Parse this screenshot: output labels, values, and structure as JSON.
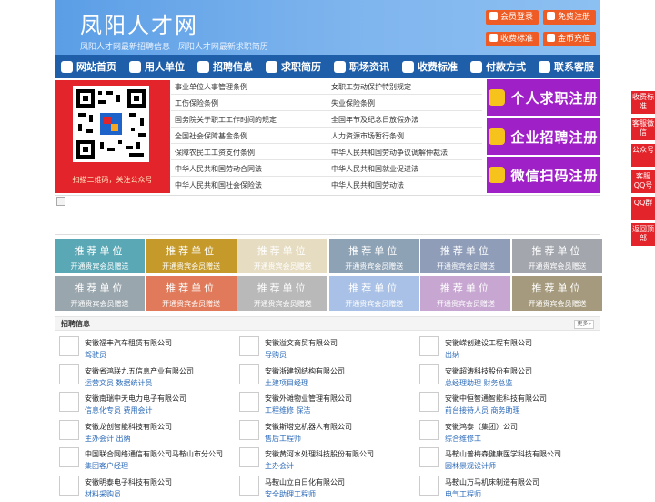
{
  "header": {
    "site_name": "凤阳人才网",
    "sub_links": [
      "凤阳人才网最新招聘信息",
      "凤阳人才网最新求职简历"
    ],
    "buttons": [
      {
        "label": "会员登录",
        "icon": "user-icon"
      },
      {
        "label": "免费注册",
        "icon": "register-icon"
      },
      {
        "label": "收费标准",
        "icon": "price-icon"
      },
      {
        "label": "金币充值",
        "icon": "coin-icon"
      }
    ],
    "accent": "#ef5b24"
  },
  "nav": {
    "items": [
      {
        "label": "网站首页",
        "icon": "home-icon"
      },
      {
        "label": "用人单位",
        "icon": "building-icon"
      },
      {
        "label": "招聘信息",
        "icon": "recruit-icon"
      },
      {
        "label": "求职简历",
        "icon": "resume-icon"
      },
      {
        "label": "职场资讯",
        "icon": "news-icon"
      },
      {
        "label": "收费标准",
        "icon": "price-icon"
      },
      {
        "label": "付款方式",
        "icon": "payment-icon"
      },
      {
        "label": "联系客服",
        "icon": "phone-icon"
      }
    ],
    "color": "#1f5ea8"
  },
  "qr": {
    "caption": "扫描二维码，关注公众号"
  },
  "laws": {
    "left": [
      "事业单位人事管理条例",
      "工伤保险条例",
      "国务院关于职工工作时间的规定",
      "全国社会保障基金条例",
      "保障农民工工资支付条例",
      "中华人民共和国劳动合同法",
      "中华人民共和国社会保险法"
    ],
    "right": [
      "女职工劳动保护特别规定",
      "失业保险条例",
      "全国年节及纪念日放假办法",
      "人力资源市场暂行条例",
      "中华人民共和国劳动争议调解仲裁法",
      "中华人民共和国就业促进法",
      "中华人民共和国劳动法"
    ]
  },
  "register": [
    {
      "label": "个人求职注册",
      "icon": "person-icon"
    },
    {
      "label": "企业招聘注册",
      "icon": "company-icon"
    },
    {
      "label": "微信扫码注册",
      "icon": "wechat-icon"
    }
  ],
  "recommend": {
    "title": "推荐单位",
    "subtitle": "开通贵宾会员赠送",
    "colors": [
      "#5aa8b5",
      "#c59a2b",
      "#e6dcc2",
      "#8ea2b5",
      "#8f9db8",
      "#a3a6ad",
      "#9aa6ad",
      "#e07a5a",
      "#b9b9b9",
      "#a9c1e6",
      "#c7a7d1",
      "#a59a7d"
    ]
  },
  "jobs": {
    "title": "招聘信息",
    "more_label": "更多»",
    "items": [
      {
        "company": "安徽福丰汽车租赁有限公司",
        "positions": "驾驶员"
      },
      {
        "company": "安徽溢文商贸有限公司",
        "positions": "导购员"
      },
      {
        "company": "安徽嵘创建设工程有限公司",
        "positions": "出纳"
      },
      {
        "company": "安徽省鸿联九五信息产业有限公司",
        "positions": "运营文员 数据统计员"
      },
      {
        "company": "安徽浙建钢结构有限公司",
        "positions": "土建项目经理"
      },
      {
        "company": "安徽超涛科技股份有限公司",
        "positions": "总经理助理 财务总监"
      },
      {
        "company": "安徽南瑞中天电力电子有限公司",
        "positions": "信息化专员 费用会计"
      },
      {
        "company": "安徽外滩物业管理有限公司",
        "positions": "工程维修 保洁"
      },
      {
        "company": "安徽中恒智通智能科技有限公司",
        "positions": "前台接待人员 商务助理"
      },
      {
        "company": "安徽龙创智能科技有限公司",
        "positions": "主办会计 出纳"
      },
      {
        "company": "安徽斯塔克机器人有限公司",
        "positions": "售后工程师"
      },
      {
        "company": "安徽鸿泰（集团）公司",
        "positions": "综合维修工"
      },
      {
        "company": "中国联合网络通信有限公司马鞍山市分公司",
        "positions": "集团客户经理"
      },
      {
        "company": "安徽黄河水处理科技股份有限公司",
        "positions": "主办会计"
      },
      {
        "company": "马鞍山普梅森健康医学科技有限公司",
        "positions": "园林景观设计师"
      },
      {
        "company": "安徽明泰电子科技有限公司",
        "positions": "材料采购员"
      },
      {
        "company": "马鞍山立白日化有限公司",
        "positions": "安全助理工程师"
      },
      {
        "company": "马鞍山万马机床制造有限公司",
        "positions": "电气工程师"
      }
    ]
  },
  "side_bar": [
    "收费标准",
    "客服微信",
    "公众号",
    "客服QQ号",
    "QQ群",
    "返回顶部"
  ]
}
